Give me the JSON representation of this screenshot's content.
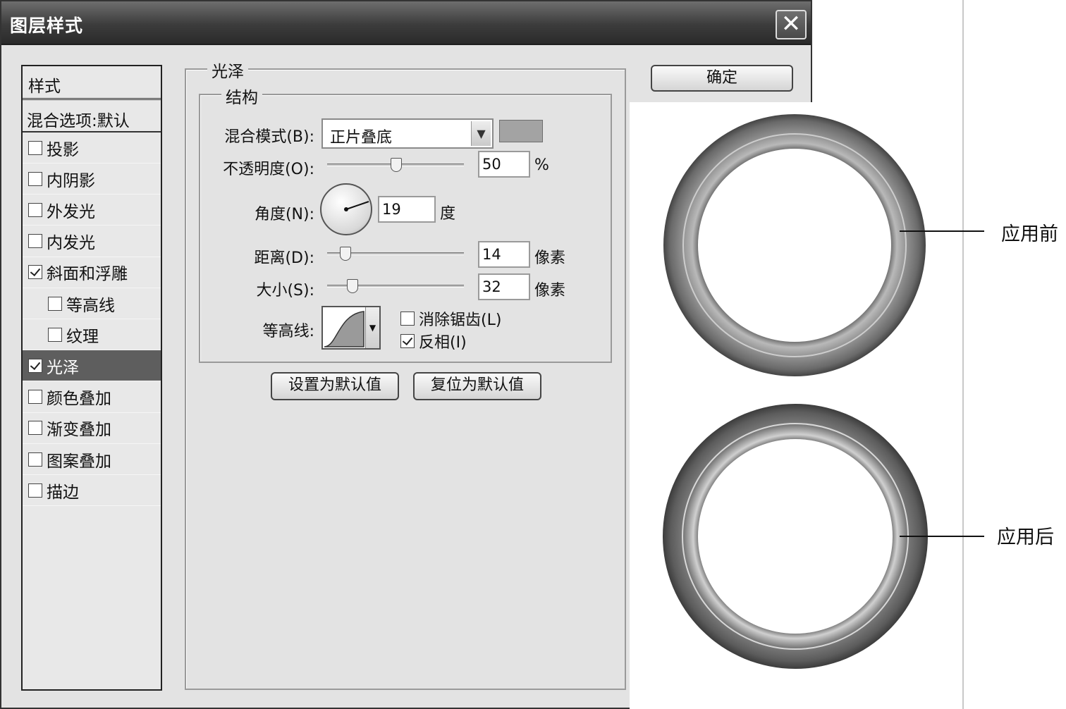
{
  "dialog": {
    "title": "图层样式",
    "close_glyph": "✕",
    "ok_label": "确定"
  },
  "style_list": {
    "header": "样式",
    "blend_options": "混合选项:默认",
    "items": [
      {
        "label": "投影",
        "checked": false,
        "indent": false,
        "selected": false
      },
      {
        "label": "内阴影",
        "checked": false,
        "indent": false,
        "selected": false
      },
      {
        "label": "外发光",
        "checked": false,
        "indent": false,
        "selected": false
      },
      {
        "label": "内发光",
        "checked": false,
        "indent": false,
        "selected": false
      },
      {
        "label": "斜面和浮雕",
        "checked": true,
        "indent": false,
        "selected": false
      },
      {
        "label": "等高线",
        "checked": false,
        "indent": true,
        "selected": false
      },
      {
        "label": "纹理",
        "checked": false,
        "indent": true,
        "selected": false
      },
      {
        "label": "光泽",
        "checked": true,
        "indent": false,
        "selected": true
      },
      {
        "label": "颜色叠加",
        "checked": false,
        "indent": false,
        "selected": false
      },
      {
        "label": "渐变叠加",
        "checked": false,
        "indent": false,
        "selected": false
      },
      {
        "label": "图案叠加",
        "checked": false,
        "indent": false,
        "selected": false
      },
      {
        "label": "描边",
        "checked": false,
        "indent": false,
        "selected": false
      }
    ]
  },
  "satin": {
    "group_title": "光泽",
    "structure_title": "结构",
    "blend_mode_label": "混合模式(B):",
    "blend_mode_value": "正片叠底",
    "swatch_color": "#a3a3a3",
    "opacity_label": "不透明度(O):",
    "opacity_value": "50",
    "opacity_unit": "%",
    "angle_label": "角度(N):",
    "angle_value": "19",
    "angle_unit": "度",
    "distance_label": "距离(D):",
    "distance_value": "14",
    "distance_unit": "像素",
    "size_label": "大小(S):",
    "size_value": "32",
    "size_unit": "像素",
    "contour_label": "等高线:",
    "antialias_label": "消除锯齿(L)",
    "antialias_checked": false,
    "invert_label": "反相(I)",
    "invert_checked": true,
    "make_default_label": "设置为默认值",
    "reset_default_label": "复位为默认值"
  },
  "illustration": {
    "before_label": "应用前",
    "after_label": "应用后"
  }
}
